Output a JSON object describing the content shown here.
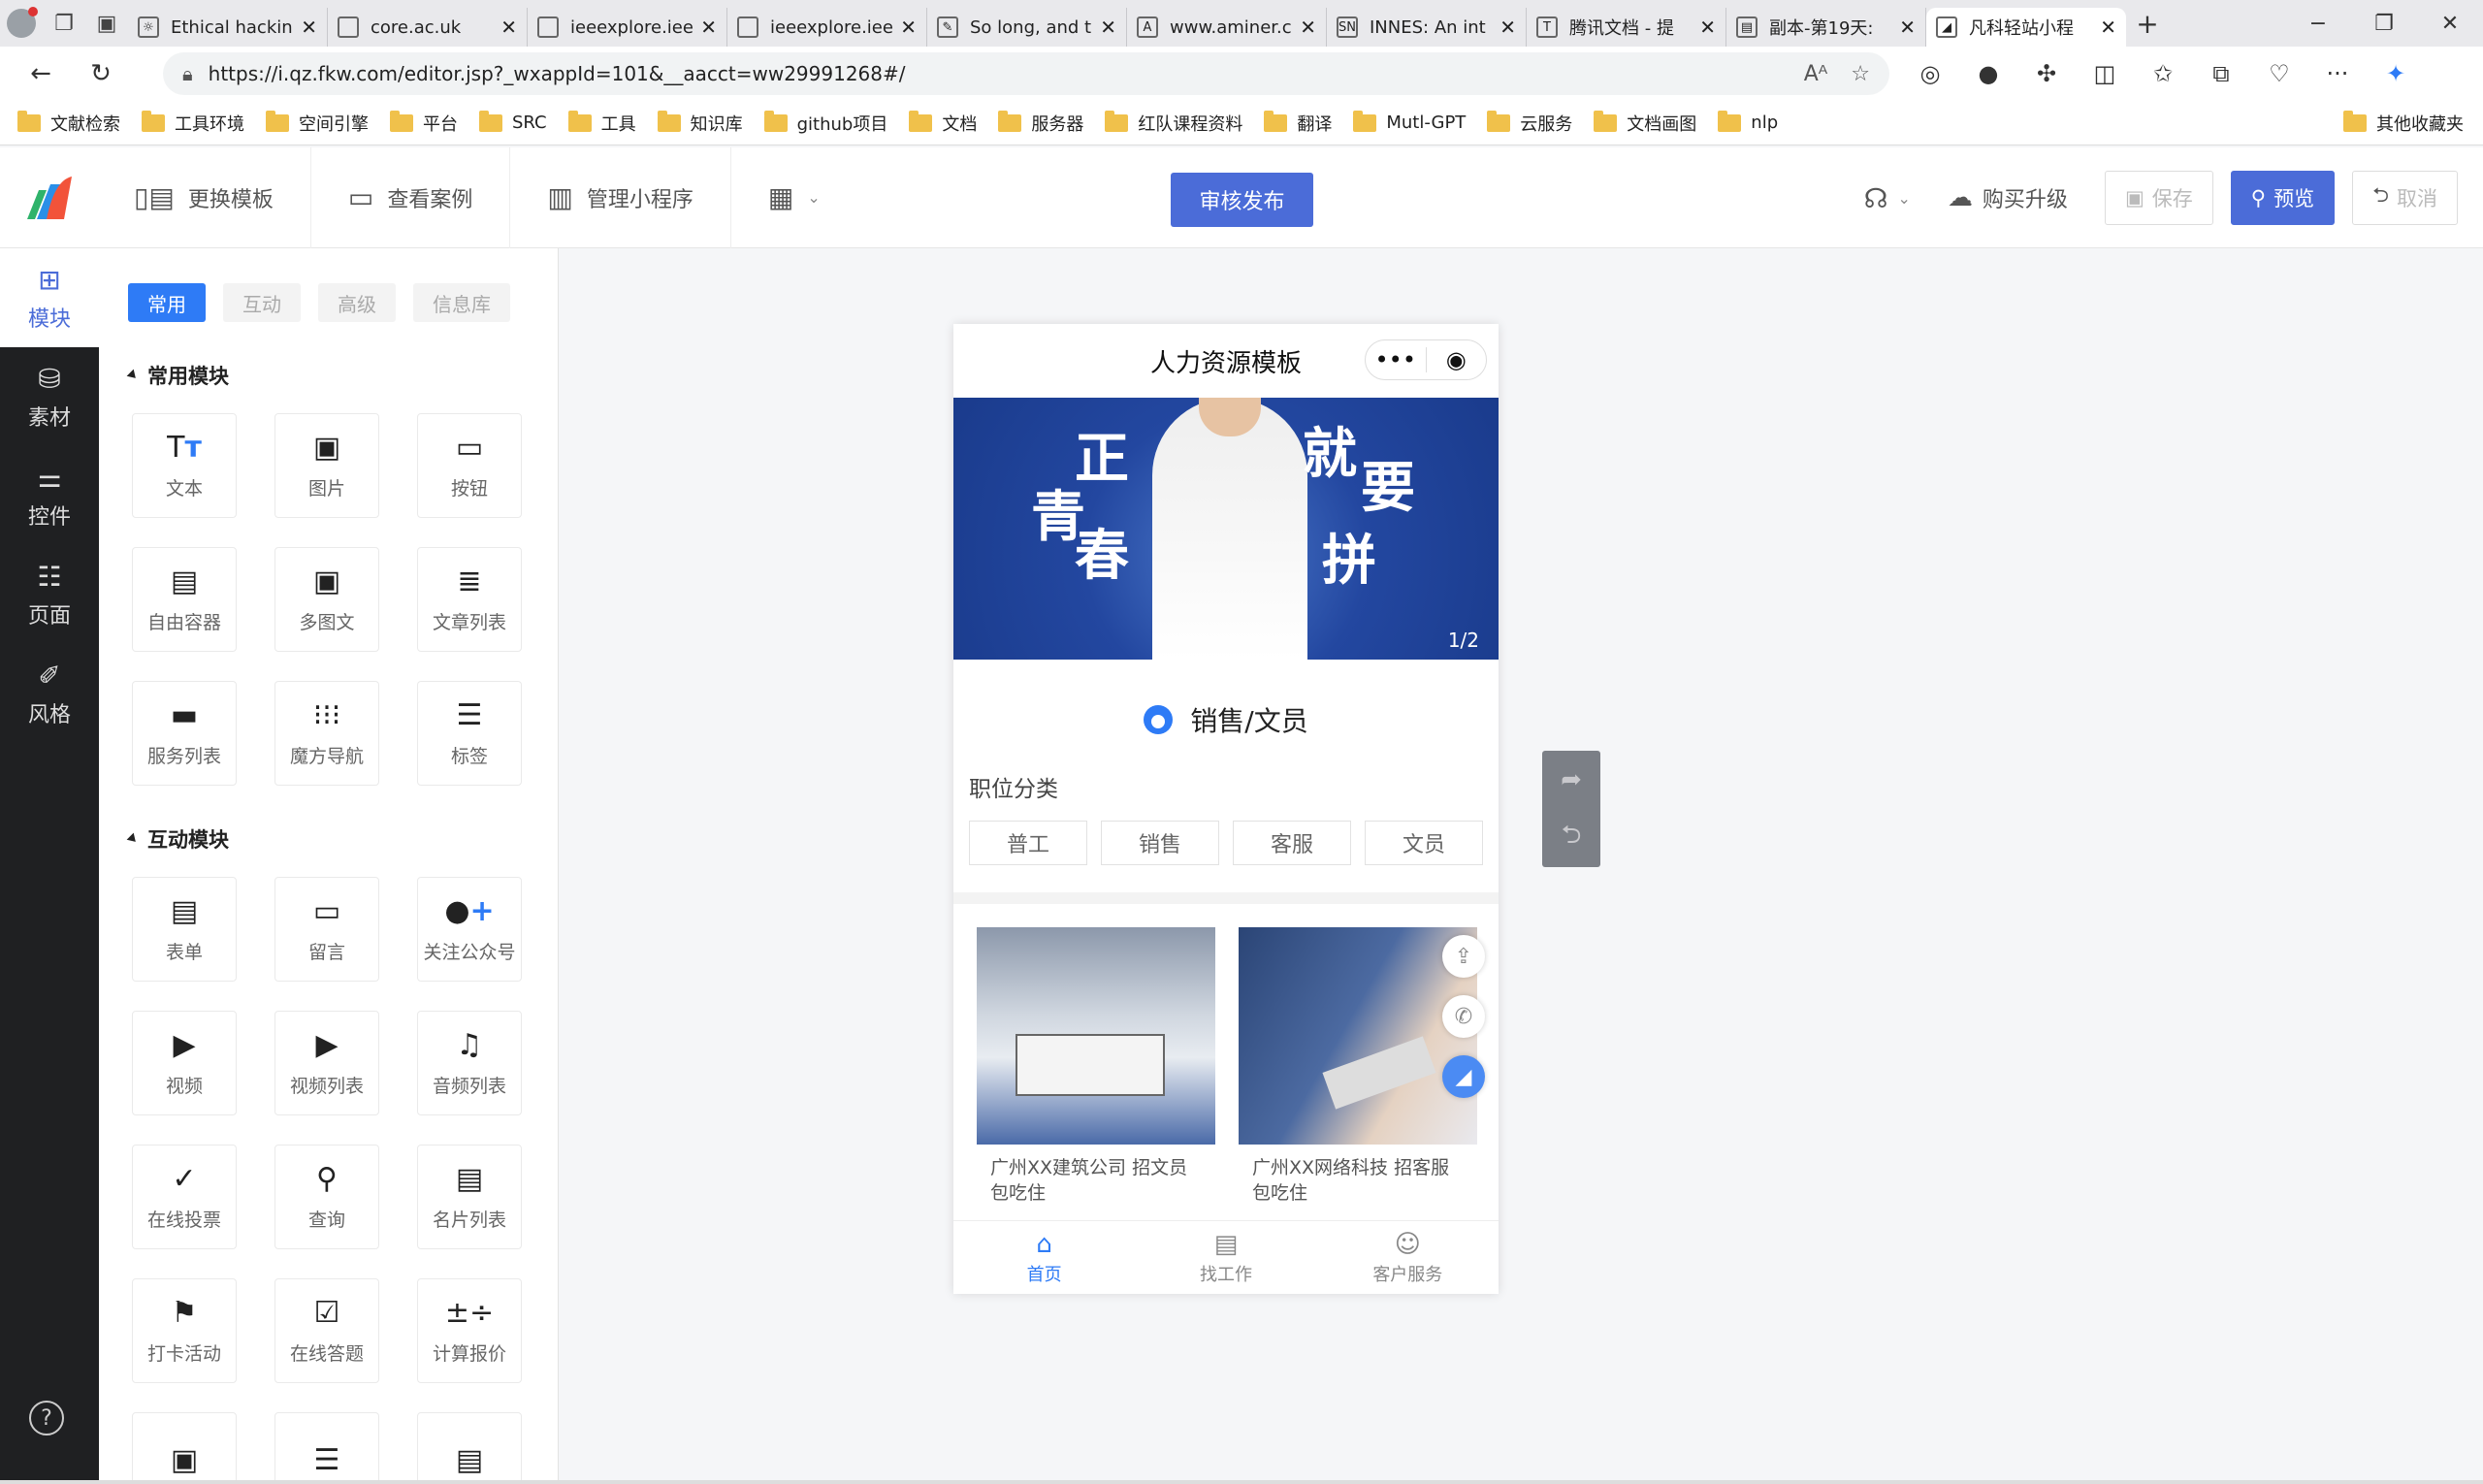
{
  "browser": {
    "tabs": [
      {
        "title": "Ethical hackin",
        "fav": "☼"
      },
      {
        "title": "core.ac.uk",
        "fav": ""
      },
      {
        "title": "ieeexplore.iee",
        "fav": ""
      },
      {
        "title": "ieeexplore.iee",
        "fav": ""
      },
      {
        "title": "So long, and t",
        "fav": "✎"
      },
      {
        "title": "www.aminer.c",
        "fav": "A"
      },
      {
        "title": "INNES: An int",
        "fav": "SN"
      },
      {
        "title": "腾讯文档 - 提",
        "fav": "T"
      },
      {
        "title": "副本-第19天:",
        "fav": "▤"
      },
      {
        "title": "凡科轻站小程",
        "fav": "◢"
      }
    ],
    "url": "https://i.qz.fkw.com/editor.jsp?_wxappId=101&__aacct=ww29991268#/",
    "bookmarks": [
      "文献检索",
      "工具环境",
      "空间引擎",
      "平台",
      "SRC",
      "工具",
      "知识库",
      "github项目",
      "文档",
      "服务器",
      "红队课程资料",
      "翻译",
      "Mutl-GPT",
      "云服务",
      "文档画图",
      "nlp"
    ],
    "other_bookmarks": "其他收藏夹",
    "folder_color": "#f0c14b"
  },
  "header": {
    "change_template": "更换模板",
    "view_cases": "查看案例",
    "manage_miniapp": "管理小程序",
    "publish": "审核发布",
    "upgrade": "购买升级",
    "save": "保存",
    "preview": "预览",
    "cancel": "取消",
    "accent": "#4b6cd8"
  },
  "leftnav": {
    "items": [
      "模块",
      "素材",
      "控件",
      "页面",
      "风格"
    ],
    "help": "?"
  },
  "panel": {
    "tabs": [
      "常用",
      "互动",
      "高级",
      "信息库"
    ],
    "sections": [
      {
        "title": "常用模块",
        "items": [
          "文本",
          "图片",
          "按钮",
          "自由容器",
          "多图文",
          "文章列表",
          "服务列表",
          "魔方导航",
          "标签"
        ]
      },
      {
        "title": "互动模块",
        "items": [
          "表单",
          "留言",
          "关注公众号",
          "视频",
          "视频列表",
          "音频列表",
          "在线投票",
          "查询",
          "名片列表",
          "打卡活动",
          "在线答题",
          "计算报价"
        ]
      }
    ]
  },
  "phone": {
    "title": "人力资源模板",
    "banner": {
      "chars": [
        "青",
        "正",
        "春",
        "就",
        "要",
        "拼"
      ],
      "pager": "1/2"
    },
    "job": {
      "title": "销售/文员",
      "label": "职位分类",
      "tags": [
        "普工",
        "销售",
        "客服",
        "文员"
      ]
    },
    "listings": [
      {
        "caption": "广州XX建筑公司 招文员 包吃住"
      },
      {
        "caption": "广州XX网络科技 招客服 包吃住"
      }
    ],
    "nav": [
      "首页",
      "找工作",
      "客户服务"
    ]
  }
}
